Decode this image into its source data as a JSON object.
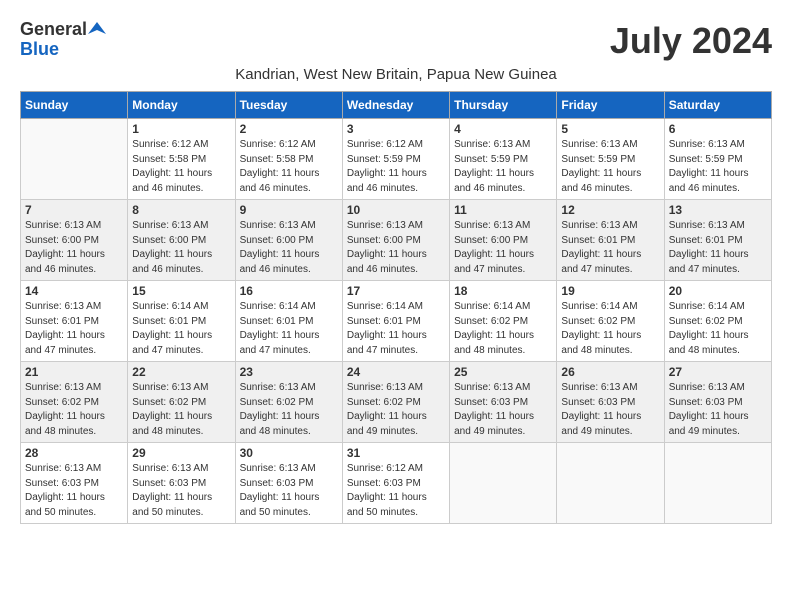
{
  "header": {
    "logo_general": "General",
    "logo_blue": "Blue",
    "title": "July 2024",
    "subtitle": "Kandrian, West New Britain, Papua New Guinea"
  },
  "weekdays": [
    "Sunday",
    "Monday",
    "Tuesday",
    "Wednesday",
    "Thursday",
    "Friday",
    "Saturday"
  ],
  "weeks": [
    [
      {
        "day": "",
        "sunrise": "",
        "sunset": "",
        "daylight": ""
      },
      {
        "day": "1",
        "sunrise": "Sunrise: 6:12 AM",
        "sunset": "Sunset: 5:58 PM",
        "daylight": "Daylight: 11 hours and 46 minutes."
      },
      {
        "day": "2",
        "sunrise": "Sunrise: 6:12 AM",
        "sunset": "Sunset: 5:58 PM",
        "daylight": "Daylight: 11 hours and 46 minutes."
      },
      {
        "day": "3",
        "sunrise": "Sunrise: 6:12 AM",
        "sunset": "Sunset: 5:59 PM",
        "daylight": "Daylight: 11 hours and 46 minutes."
      },
      {
        "day": "4",
        "sunrise": "Sunrise: 6:13 AM",
        "sunset": "Sunset: 5:59 PM",
        "daylight": "Daylight: 11 hours and 46 minutes."
      },
      {
        "day": "5",
        "sunrise": "Sunrise: 6:13 AM",
        "sunset": "Sunset: 5:59 PM",
        "daylight": "Daylight: 11 hours and 46 minutes."
      },
      {
        "day": "6",
        "sunrise": "Sunrise: 6:13 AM",
        "sunset": "Sunset: 5:59 PM",
        "daylight": "Daylight: 11 hours and 46 minutes."
      }
    ],
    [
      {
        "day": "7",
        "sunrise": "Sunrise: 6:13 AM",
        "sunset": "Sunset: 6:00 PM",
        "daylight": "Daylight: 11 hours and 46 minutes."
      },
      {
        "day": "8",
        "sunrise": "Sunrise: 6:13 AM",
        "sunset": "Sunset: 6:00 PM",
        "daylight": "Daylight: 11 hours and 46 minutes."
      },
      {
        "day": "9",
        "sunrise": "Sunrise: 6:13 AM",
        "sunset": "Sunset: 6:00 PM",
        "daylight": "Daylight: 11 hours and 46 minutes."
      },
      {
        "day": "10",
        "sunrise": "Sunrise: 6:13 AM",
        "sunset": "Sunset: 6:00 PM",
        "daylight": "Daylight: 11 hours and 46 minutes."
      },
      {
        "day": "11",
        "sunrise": "Sunrise: 6:13 AM",
        "sunset": "Sunset: 6:00 PM",
        "daylight": "Daylight: 11 hours and 47 minutes."
      },
      {
        "day": "12",
        "sunrise": "Sunrise: 6:13 AM",
        "sunset": "Sunset: 6:01 PM",
        "daylight": "Daylight: 11 hours and 47 minutes."
      },
      {
        "day": "13",
        "sunrise": "Sunrise: 6:13 AM",
        "sunset": "Sunset: 6:01 PM",
        "daylight": "Daylight: 11 hours and 47 minutes."
      }
    ],
    [
      {
        "day": "14",
        "sunrise": "Sunrise: 6:13 AM",
        "sunset": "Sunset: 6:01 PM",
        "daylight": "Daylight: 11 hours and 47 minutes."
      },
      {
        "day": "15",
        "sunrise": "Sunrise: 6:14 AM",
        "sunset": "Sunset: 6:01 PM",
        "daylight": "Daylight: 11 hours and 47 minutes."
      },
      {
        "day": "16",
        "sunrise": "Sunrise: 6:14 AM",
        "sunset": "Sunset: 6:01 PM",
        "daylight": "Daylight: 11 hours and 47 minutes."
      },
      {
        "day": "17",
        "sunrise": "Sunrise: 6:14 AM",
        "sunset": "Sunset: 6:01 PM",
        "daylight": "Daylight: 11 hours and 47 minutes."
      },
      {
        "day": "18",
        "sunrise": "Sunrise: 6:14 AM",
        "sunset": "Sunset: 6:02 PM",
        "daylight": "Daylight: 11 hours and 48 minutes."
      },
      {
        "day": "19",
        "sunrise": "Sunrise: 6:14 AM",
        "sunset": "Sunset: 6:02 PM",
        "daylight": "Daylight: 11 hours and 48 minutes."
      },
      {
        "day": "20",
        "sunrise": "Sunrise: 6:14 AM",
        "sunset": "Sunset: 6:02 PM",
        "daylight": "Daylight: 11 hours and 48 minutes."
      }
    ],
    [
      {
        "day": "21",
        "sunrise": "Sunrise: 6:13 AM",
        "sunset": "Sunset: 6:02 PM",
        "daylight": "Daylight: 11 hours and 48 minutes."
      },
      {
        "day": "22",
        "sunrise": "Sunrise: 6:13 AM",
        "sunset": "Sunset: 6:02 PM",
        "daylight": "Daylight: 11 hours and 48 minutes."
      },
      {
        "day": "23",
        "sunrise": "Sunrise: 6:13 AM",
        "sunset": "Sunset: 6:02 PM",
        "daylight": "Daylight: 11 hours and 48 minutes."
      },
      {
        "day": "24",
        "sunrise": "Sunrise: 6:13 AM",
        "sunset": "Sunset: 6:02 PM",
        "daylight": "Daylight: 11 hours and 49 minutes."
      },
      {
        "day": "25",
        "sunrise": "Sunrise: 6:13 AM",
        "sunset": "Sunset: 6:03 PM",
        "daylight": "Daylight: 11 hours and 49 minutes."
      },
      {
        "day": "26",
        "sunrise": "Sunrise: 6:13 AM",
        "sunset": "Sunset: 6:03 PM",
        "daylight": "Daylight: 11 hours and 49 minutes."
      },
      {
        "day": "27",
        "sunrise": "Sunrise: 6:13 AM",
        "sunset": "Sunset: 6:03 PM",
        "daylight": "Daylight: 11 hours and 49 minutes."
      }
    ],
    [
      {
        "day": "28",
        "sunrise": "Sunrise: 6:13 AM",
        "sunset": "Sunset: 6:03 PM",
        "daylight": "Daylight: 11 hours and 50 minutes."
      },
      {
        "day": "29",
        "sunrise": "Sunrise: 6:13 AM",
        "sunset": "Sunset: 6:03 PM",
        "daylight": "Daylight: 11 hours and 50 minutes."
      },
      {
        "day": "30",
        "sunrise": "Sunrise: 6:13 AM",
        "sunset": "Sunset: 6:03 PM",
        "daylight": "Daylight: 11 hours and 50 minutes."
      },
      {
        "day": "31",
        "sunrise": "Sunrise: 6:12 AM",
        "sunset": "Sunset: 6:03 PM",
        "daylight": "Daylight: 11 hours and 50 minutes."
      },
      {
        "day": "",
        "sunrise": "",
        "sunset": "",
        "daylight": ""
      },
      {
        "day": "",
        "sunrise": "",
        "sunset": "",
        "daylight": ""
      },
      {
        "day": "",
        "sunrise": "",
        "sunset": "",
        "daylight": ""
      }
    ]
  ]
}
